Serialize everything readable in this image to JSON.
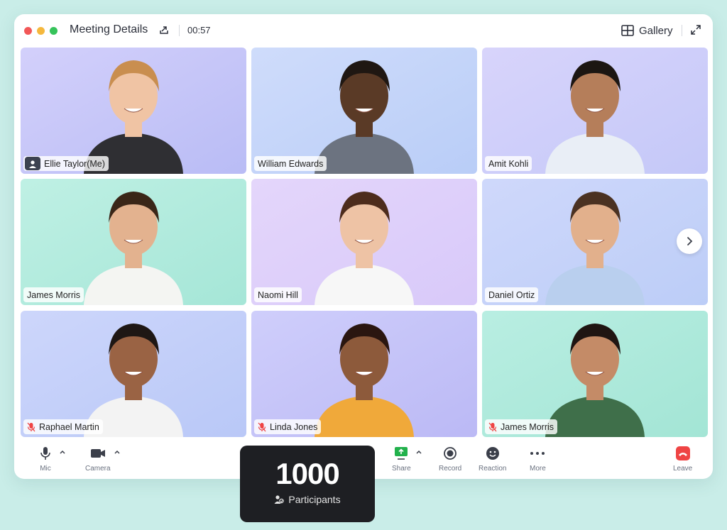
{
  "window": {
    "title": "Meeting Details",
    "timer": "00:57",
    "view_label": "Gallery"
  },
  "participants": [
    {
      "name": "Ellie Taylor(Me)",
      "is_me": true,
      "muted": false,
      "bg": [
        "#d3d0fb",
        "#b9bcf5"
      ],
      "skin": "#f0c4a4",
      "hair": "#c98e4f",
      "shirt": "#2f2f33"
    },
    {
      "name": "William Edwards",
      "is_me": false,
      "muted": false,
      "bg": [
        "#cfdcfb",
        "#b9cdf7"
      ],
      "skin": "#5a3a26",
      "hair": "#1f1712",
      "shirt": "#6c7380"
    },
    {
      "name": "Amit Kohli",
      "is_me": false,
      "muted": false,
      "bg": [
        "#d8d4fb",
        "#c4c8f8"
      ],
      "skin": "#b57e5a",
      "hair": "#1c1612",
      "shirt": "#e9eef6"
    },
    {
      "name": "James Morris",
      "is_me": false,
      "muted": false,
      "bg": [
        "#bff0e4",
        "#a5e6d7"
      ],
      "skin": "#e3b28f",
      "hair": "#3a2618",
      "shirt": "#f4f5f2"
    },
    {
      "name": "Naomi Hill",
      "is_me": false,
      "muted": false,
      "bg": [
        "#e4d6fb",
        "#d8c9f9"
      ],
      "skin": "#eec3a5",
      "hair": "#4d2c1c",
      "shirt": "#f7f7f7"
    },
    {
      "name": "Daniel Ortiz",
      "is_me": false,
      "muted": false,
      "bg": [
        "#cfd8fb",
        "#bccdf7"
      ],
      "skin": "#e2b08c",
      "hair": "#4b3222",
      "shirt": "#b9cfee"
    },
    {
      "name": "Raphael Martin",
      "is_me": false,
      "muted": true,
      "bg": [
        "#cdd6fb",
        "#b9c8f7"
      ],
      "skin": "#9a6344",
      "hair": "#1e1714",
      "shirt": "#f3f3f3"
    },
    {
      "name": "Linda Jones",
      "is_me": false,
      "muted": true,
      "bg": [
        "#cfcefb",
        "#bbb9f5"
      ],
      "skin": "#8d5a3b",
      "hair": "#2a1610",
      "shirt": "#f0a93a"
    },
    {
      "name": "James Morris",
      "is_me": false,
      "muted": true,
      "bg": [
        "#b9eee2",
        "#a3e5d5"
      ],
      "skin": "#c48b67",
      "hair": "#1f1512",
      "shirt": "#3f6f4a"
    }
  ],
  "controls": {
    "mic": "Mic",
    "camera": "Camera",
    "share": "Share",
    "record": "Record",
    "reaction": "Reaction",
    "more": "More",
    "leave": "Leave"
  },
  "participants_card": {
    "count": "1000",
    "label": "Participants"
  },
  "colors": {
    "share_green": "#22b14c",
    "leave_red": "#ef4444",
    "card_dark": "#1e1f23"
  }
}
